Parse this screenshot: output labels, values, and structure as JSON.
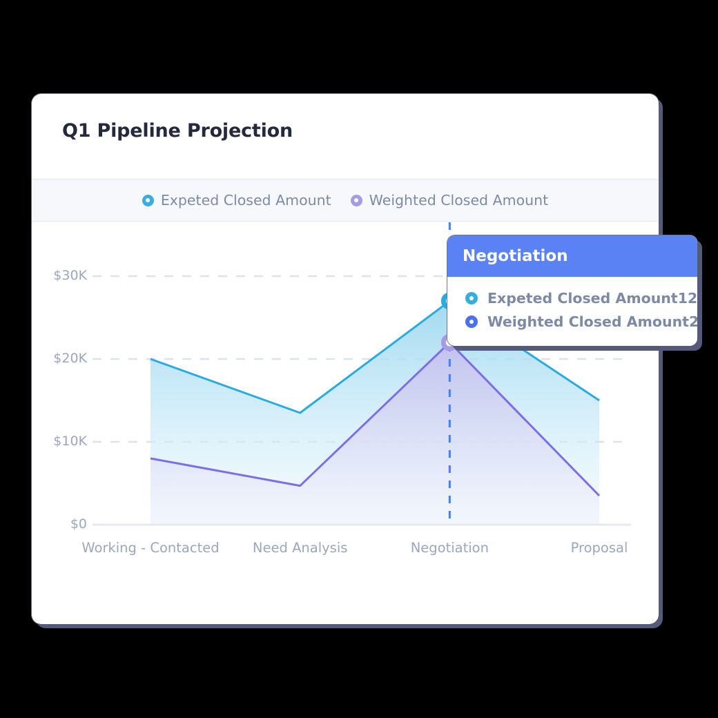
{
  "card": {
    "title": "Q1 Pipeline Projection"
  },
  "legend": {
    "items": [
      {
        "label": "Expeted Closed Amount",
        "color": "#3badE0"
      },
      {
        "label": "Weighted Closed Amount",
        "color": "#a79ae6"
      }
    ]
  },
  "tooltip": {
    "header": "Negotiation",
    "header_color": "#5b82f5",
    "rows": [
      {
        "label": "Expeted Closed Amount",
        "value": "12",
        "color": "#36ade0"
      },
      {
        "label": "Weighted Closed Amount",
        "value": "2",
        "color": "#4a6ff0"
      }
    ]
  },
  "chart_data": {
    "type": "area",
    "title": "Q1 Pipeline Projection",
    "xlabel": "",
    "ylabel": "",
    "categories": [
      "Working - Contacted",
      "Need Analysis",
      "Negotiation",
      "Proposal"
    ],
    "series": [
      {
        "name": "Expeted Closed Amount",
        "color": "#29abe2",
        "fill_top": "#9ed8f0",
        "fill_bottom": "#eaf7fd",
        "values": [
          20000,
          13500,
          27000,
          15000
        ]
      },
      {
        "name": "Weighted Closed Amount",
        "color": "#7b6fe8",
        "fill_top": "#c3c0ee",
        "fill_bottom": "#f0f1fb",
        "values": [
          8000,
          4700,
          22000,
          3500
        ]
      }
    ],
    "ylim": [
      0,
      34500
    ],
    "yticks": [
      0,
      10000,
      20000,
      30000
    ],
    "ytick_labels": [
      "$0",
      "$10K",
      "$20K",
      "$30K"
    ],
    "grid": true,
    "grid_style": "dashed",
    "grid_color": "#dde1e9",
    "legend_position": "top",
    "highlight": {
      "category": "Negotiation",
      "line_color": "#4a7df5",
      "line_style": "dashed",
      "markers": [
        {
          "series": "Expeted Closed Amount",
          "value": 27000,
          "color": "#29abe2"
        },
        {
          "series": "Weighted Closed Amount",
          "value": 22000,
          "color": "#a79ae6"
        }
      ]
    },
    "axis_color": "#e4e7ef"
  }
}
